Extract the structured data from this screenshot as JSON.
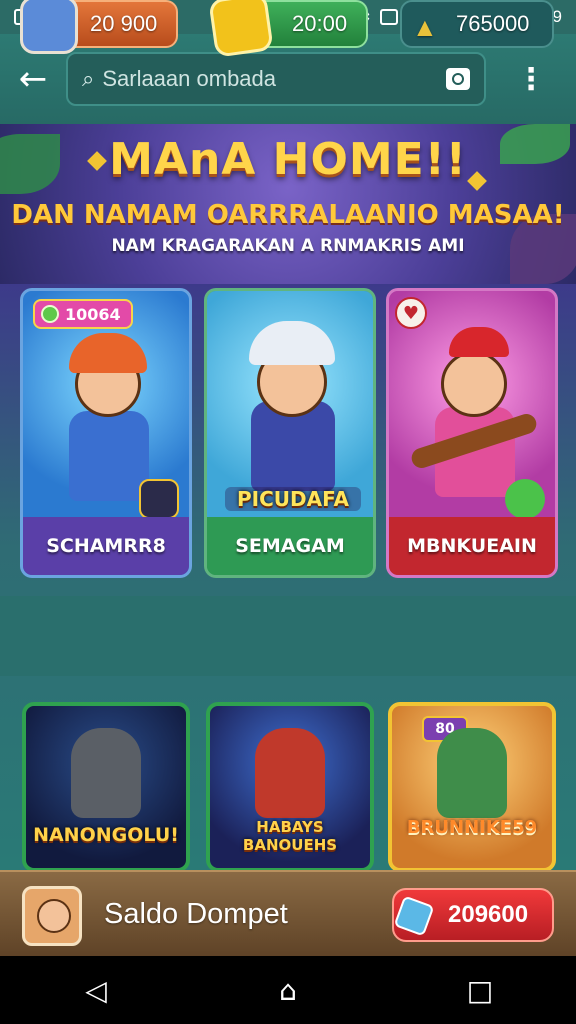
{
  "status_bar": {
    "time": "13:29"
  },
  "app_bar": {
    "back_icon": "arrow-left-icon",
    "search": {
      "value": "Sarlaaan ombada"
    },
    "menu_icon": "more-vertical-icon"
  },
  "banner": {
    "title": "MAnA HOME!!",
    "subtitle": "DAN NAMAM OARRRALAANIO MASAA!",
    "tagline": "NAM KRAGARAKAN A RNMAKRIS AMI"
  },
  "character_cards": [
    {
      "label": "SCHAMRR8",
      "badge": "10064",
      "color": "#5a3fa8"
    },
    {
      "label": "SEMAGAM",
      "art_text": "PICUDAFA",
      "color": "#2e9a54"
    },
    {
      "label": "MBNKUEAIN",
      "color": "#c2272f"
    }
  ],
  "currency": [
    {
      "value": "20 900",
      "icon": "avatar-icon"
    },
    {
      "value": "20:00",
      "icon": "gold-gem-icon"
    },
    {
      "value": "765000",
      "icon": "crystal-icon"
    }
  ],
  "game_tiles": [
    {
      "title": "NANONGOLU!"
    },
    {
      "title": "HABAYS BANOUEHS"
    },
    {
      "title": "BRUNNIKE59",
      "count": "80"
    }
  ],
  "wallet": {
    "label": "Saldo Dompet",
    "value": "209600"
  },
  "nav": {
    "back": "◁",
    "home": "⌂",
    "recents": "□"
  },
  "colors": {
    "app_bar": "#2d7a73",
    "banner_title": "#ffd54a",
    "wallet_pill": "#f0393a"
  }
}
